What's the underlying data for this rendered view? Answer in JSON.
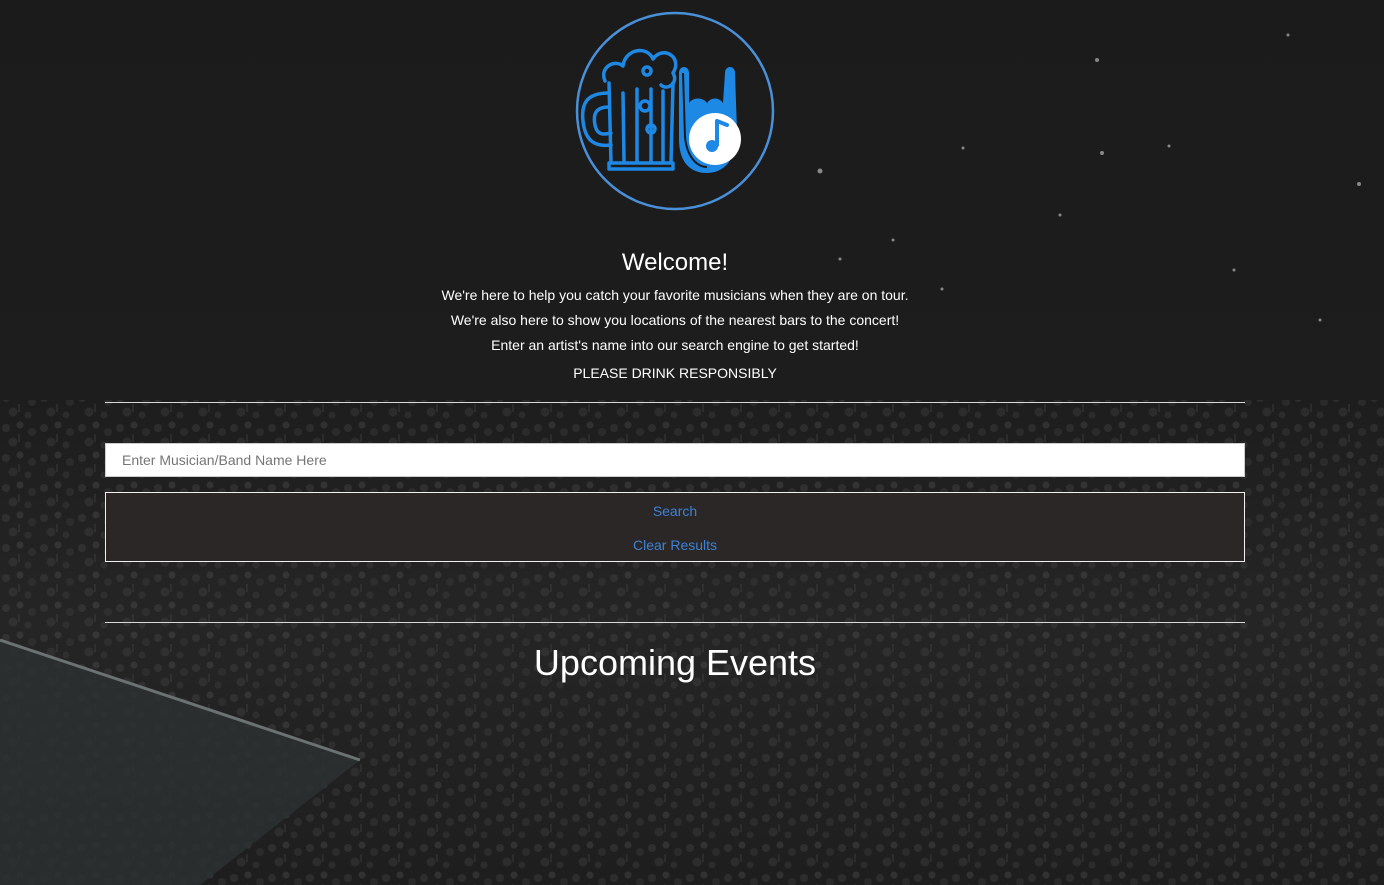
{
  "header": {
    "welcome": "Welcome!",
    "lines": [
      "We're here to help you catch your favorite musicians when they are on tour.",
      "We're also here to show you locations of the nearest bars to the concert!",
      "Enter an artist's name into our search engine to get started!",
      "PLEASE DRINK RESPONSIBLY"
    ]
  },
  "search": {
    "placeholder": "Enter Musician/Band Name Here",
    "value": "",
    "search_label": "Search",
    "clear_label": "Clear Results"
  },
  "events": {
    "title": "Upcoming Events"
  },
  "colors": {
    "accent": "#1e88e5",
    "button_text": "#3b82d6",
    "button_box_bg": "#2c2727"
  },
  "icons": {
    "logo": "beer-mug-rock-hand-music-note-logo"
  }
}
